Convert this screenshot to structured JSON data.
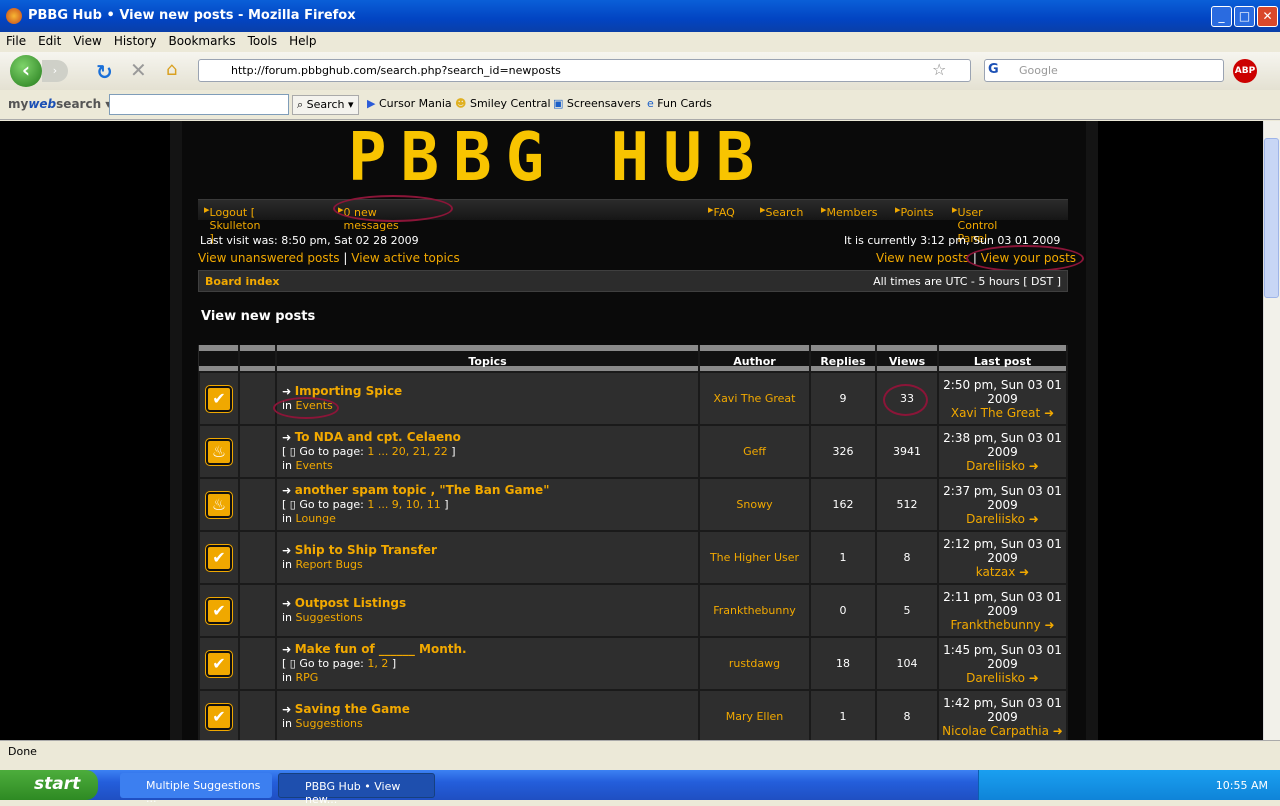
{
  "window": {
    "title": "PBBG Hub • View new posts - Mozilla Firefox"
  },
  "menu": [
    "File",
    "Edit",
    "View",
    "History",
    "Bookmarks",
    "Tools",
    "Help"
  ],
  "address": {
    "url": "http://forum.pbbghub.com/search.php?search_id=newposts"
  },
  "google": {
    "placeholder": "Google"
  },
  "toolbar2": {
    "brand_a": "my",
    "brand_b": "web",
    "brand_c": "search",
    "search_label": "Search",
    "links": [
      "Cursor Mania",
      "Smiley Central",
      "Screensavers",
      "Fun Cards"
    ]
  },
  "site": {
    "logo": "PBBG HUB",
    "nav_left": [
      "Logout [ Skulleton ]",
      "0 new messages"
    ],
    "nav_right": [
      "FAQ",
      "Search",
      "Members",
      "Points",
      "User Control Panel"
    ],
    "last_visit": "Last visit was: 8:50 pm, Sat 02 28 2009",
    "current": "It is currently 3:12 pm, Sun 03 01 2009",
    "links_left": [
      "View unanswered posts",
      "View active topics"
    ],
    "links_right": [
      "View new posts",
      "View your posts"
    ],
    "board_index": "Board index",
    "timezone": "All times are UTC - 5 hours [ DST ]",
    "page_title": "View new posts"
  },
  "table": {
    "headers": [
      "Topics",
      "Author",
      "Replies",
      "Views",
      "Last post"
    ],
    "rows": [
      {
        "icon": "check",
        "title": "Importing Spice",
        "pages": "",
        "forum": "Events",
        "author": "Xavi The Great",
        "replies": "9",
        "views": "33",
        "last_time": "2:50 pm, Sun 03 01 2009",
        "last_user": "Xavi The Great"
      },
      {
        "icon": "hot",
        "title": "To NDA and cpt. Celaeno",
        "pages": "1 ... 20, 21, 22",
        "forum": "Events",
        "author": "Geff",
        "replies": "326",
        "views": "3941",
        "last_time": "2:38 pm, Sun 03 01 2009",
        "last_user": "Dareliisko"
      },
      {
        "icon": "hot-star",
        "title": "another spam topic , \"The Ban Game\"",
        "pages": "1 ... 9, 10, 11",
        "forum": "Lounge",
        "author": "Snowy",
        "replies": "162",
        "views": "512",
        "last_time": "2:37 pm, Sun 03 01 2009",
        "last_user": "Dareliisko"
      },
      {
        "icon": "check",
        "title": "Ship to Ship Transfer",
        "pages": "",
        "forum": "Report Bugs",
        "author": "The Higher User",
        "replies": "1",
        "views": "8",
        "last_time": "2:12 pm, Sun 03 01 2009",
        "last_user": "katzax"
      },
      {
        "icon": "check",
        "title": "Outpost Listings",
        "pages": "",
        "forum": "Suggestions",
        "author": "Frankthebunny",
        "replies": "0",
        "views": "5",
        "last_time": "2:11 pm, Sun 03 01 2009",
        "last_user": "Frankthebunny"
      },
      {
        "icon": "check",
        "title": "Make fun of ______ Month.",
        "pages": "1, 2",
        "forum": "RPG",
        "author": "rustdawg",
        "replies": "18",
        "views": "104",
        "last_time": "1:45 pm, Sun 03 01 2009",
        "last_user": "Dareliisko"
      },
      {
        "icon": "check",
        "title": "Saving the Game",
        "pages": "",
        "forum": "Suggestions",
        "author": "Mary Ellen",
        "replies": "1",
        "views": "8",
        "last_time": "1:42 pm, Sun 03 01 2009",
        "last_user": "Nicolae Carpathia"
      }
    ],
    "goto": "Go to page:",
    "in": "in"
  },
  "status": {
    "text": "Done"
  },
  "taskbar": {
    "start": "start",
    "tasks": [
      "Multiple Suggestions ...",
      "PBBG Hub • View new..."
    ],
    "clock": "10:55 AM"
  },
  "colors": {
    "accent": "#f2a900",
    "logo": "#f8c400",
    "annotation": "#8b1538"
  }
}
